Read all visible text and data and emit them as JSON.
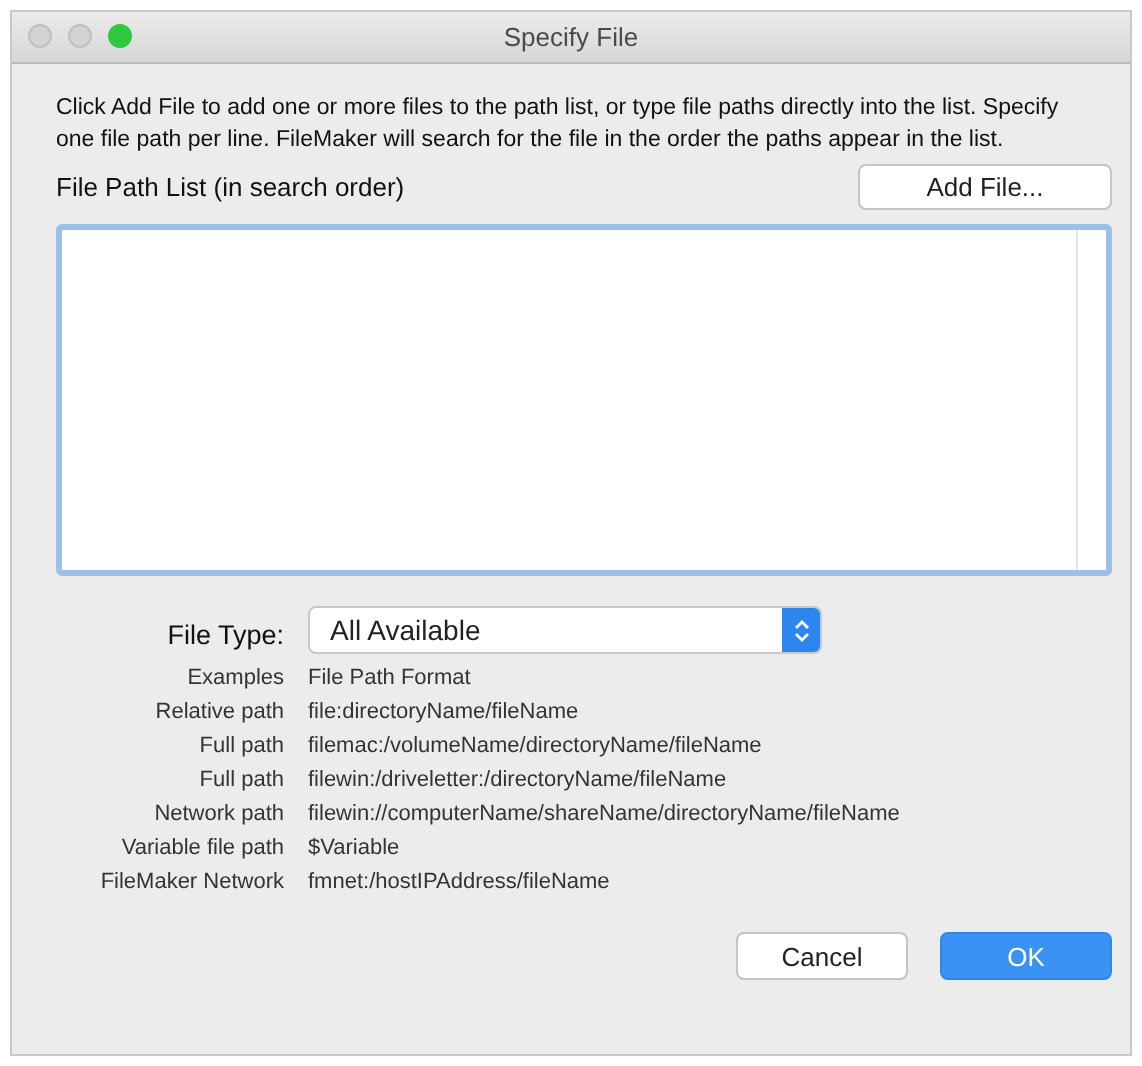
{
  "window": {
    "title": "Specify File"
  },
  "instructions": "Click Add File to add one or more files to the path list, or type file paths directly into the list. Specify one file path per line. FileMaker will search for the file in the order the paths appear in the list.",
  "path_list": {
    "label": "File Path List (in search order)",
    "add_button": "Add File...",
    "focused": true
  },
  "file_type": {
    "label": "File Type:",
    "value": "All Available"
  },
  "examples": {
    "header": {
      "label": "Examples",
      "format": "File Path Format"
    },
    "rows": [
      {
        "label": "Relative path",
        "format": "file:directoryName/fileName"
      },
      {
        "label": "Full path",
        "format": "filemac:/volumeName/directoryName/fileName"
      },
      {
        "label": "Full path",
        "format": "filewin:/driveletter:/directoryName/fileName"
      },
      {
        "label": "Network path",
        "format": "filewin://computerName/shareName/directoryName/fileName"
      },
      {
        "label": "Variable file path",
        "format": "$Variable"
      },
      {
        "label": "FileMaker Network",
        "format": "fmnet:/hostIPAddress/fileName"
      }
    ]
  },
  "buttons": [
    {
      "label": "Cancel",
      "kind": "secondary"
    },
    {
      "label": "OK",
      "kind": "default"
    }
  ]
}
